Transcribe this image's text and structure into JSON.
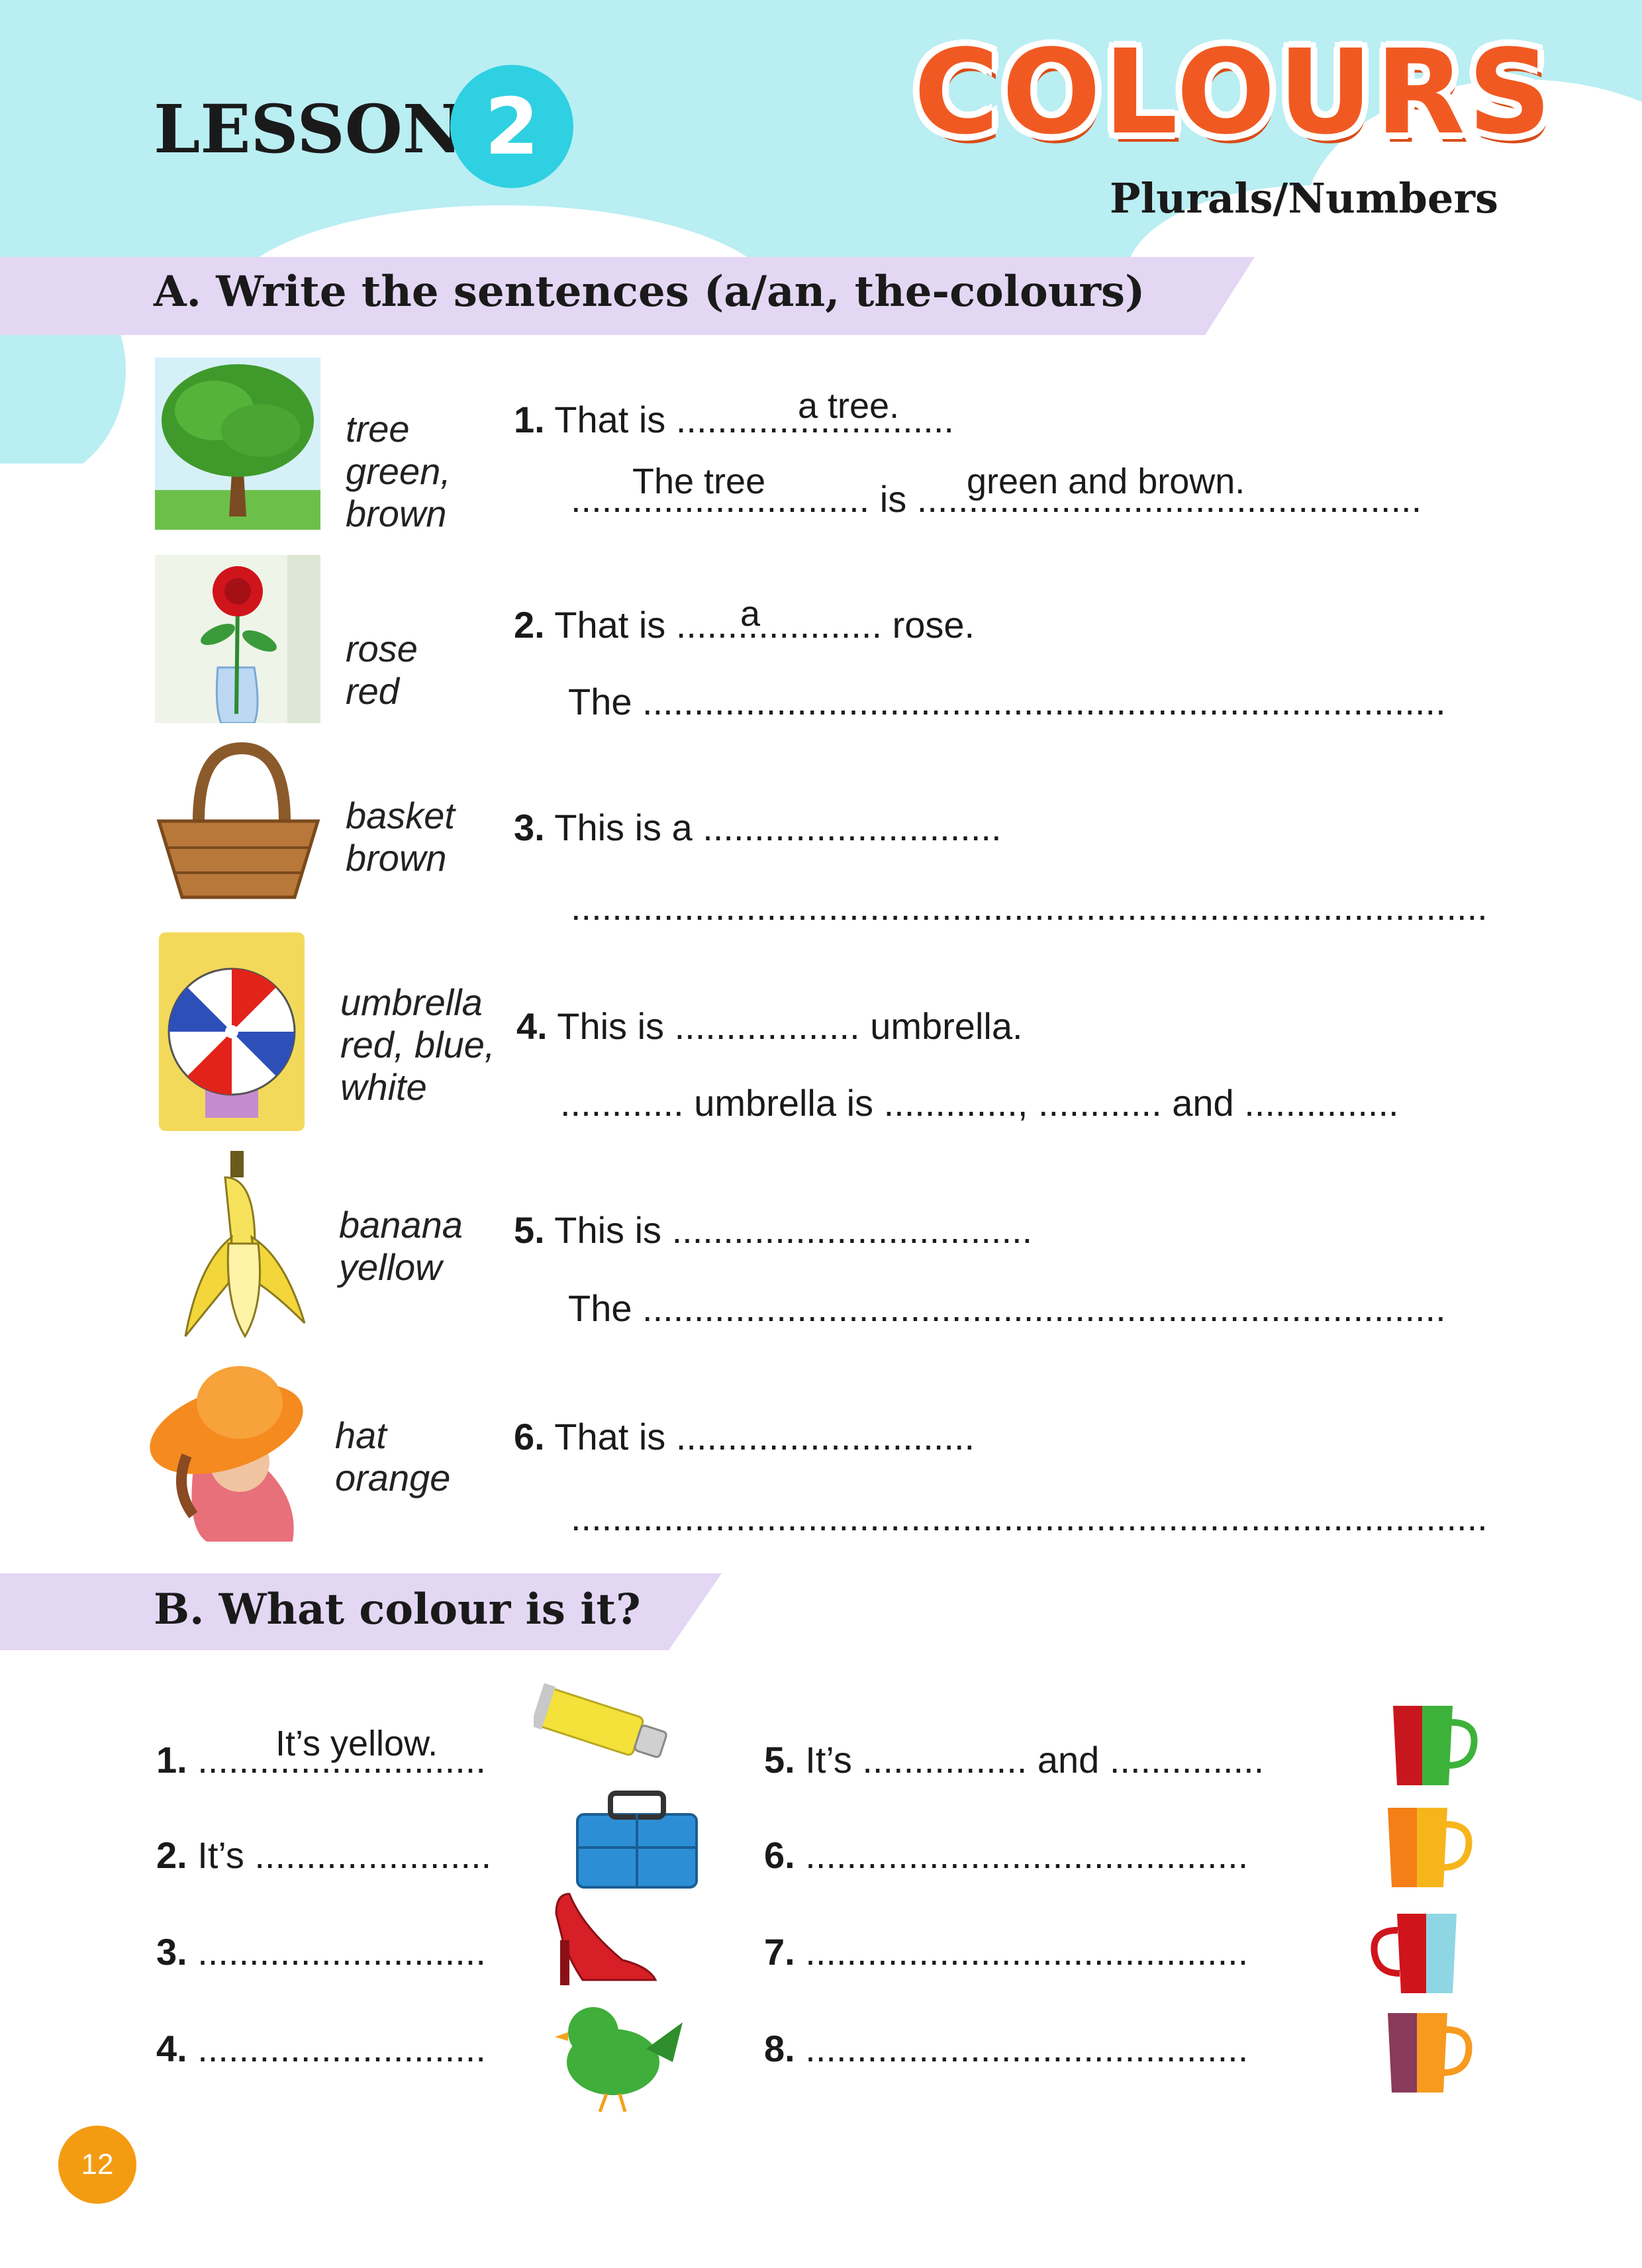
{
  "header": {
    "lesson_label": "LESSON",
    "lesson_number": "2",
    "title": "COLOURS",
    "subtitle": "Plurals/Numbers"
  },
  "section_a": {
    "heading": "A. Write the sentences (a/an, the-colours)",
    "items": [
      {
        "words": [
          "tree",
          "green,",
          "brown"
        ],
        "num": "1.",
        "line1": "That is ...........................",
        "line2a": ".............................",
        "line2b": "is",
        "line2c": ".................................................",
        "ans1": "a tree.",
        "ans2": "The tree",
        "ans3": "green and brown."
      },
      {
        "words": [
          "rose",
          "red"
        ],
        "num": "2.",
        "line1": "That is .................... rose.",
        "line2": "The ..............................................................................",
        "ans1": "a"
      },
      {
        "words": [
          "basket",
          "brown"
        ],
        "num": "3.",
        "line1": "This is a .............................",
        "line2": "........................................................................................."
      },
      {
        "words": [
          "umbrella",
          "red, blue,",
          "white"
        ],
        "num": "4.",
        "line1": "This is .................. umbrella.",
        "line2": "............ umbrella is ............., ............ and ..............."
      },
      {
        "words": [
          "banana",
          "yellow"
        ],
        "num": "5.",
        "line1": "This is ...................................",
        "line2": "The .............................................................................."
      },
      {
        "words": [
          "hat",
          "orange"
        ],
        "num": "6.",
        "line1": "That is .............................",
        "line2": "........................................................................................."
      }
    ]
  },
  "section_b": {
    "heading": "B. What colour is it?",
    "left": [
      {
        "num": "1.",
        "text": "............................",
        "ans": "It’s yellow."
      },
      {
        "num": "2.",
        "text": "It’s ......................."
      },
      {
        "num": "3.",
        "text": "............................"
      },
      {
        "num": "4.",
        "text": "............................"
      }
    ],
    "right": [
      {
        "num": "5.",
        "text": "It’s ................ and ..............."
      },
      {
        "num": "6.",
        "text": "..........................................."
      },
      {
        "num": "7.",
        "text": "..........................................."
      },
      {
        "num": "8.",
        "text": "..........................................."
      }
    ]
  },
  "footer": {
    "page_number": "12"
  },
  "colors": {
    "sky": "#b9eef3",
    "lesson_circle": "#2fd0e2",
    "title_orange": "#f05a22",
    "banner": "#e3d7f4",
    "page_circle": "#f39c12"
  }
}
